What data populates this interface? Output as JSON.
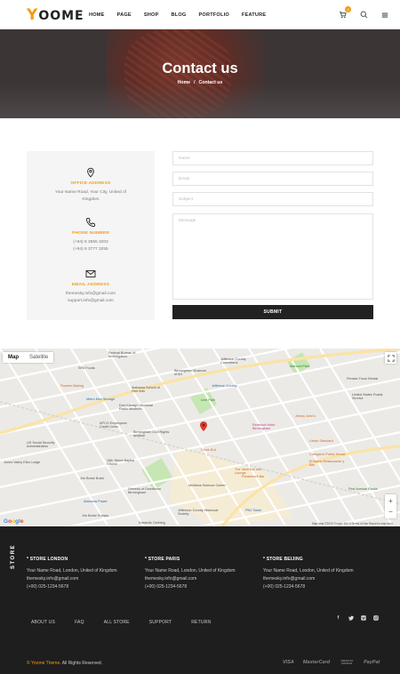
{
  "brand": {
    "logo_initial": "Y",
    "logo_rest": "OOME",
    "accent_color": "#f39c12"
  },
  "nav": {
    "items": [
      "HOME",
      "PAGE",
      "SHOP",
      "BLOG",
      "PORTFOLIO",
      "FEATURE"
    ],
    "cart_count": "0",
    "icons": [
      "cart-icon",
      "search-icon",
      "menu-icon"
    ]
  },
  "hero": {
    "title": "Contact us",
    "breadcrumb_home": "Home",
    "breadcrumb_sep": "/",
    "breadcrumb_current": "Contact us"
  },
  "contact_info": {
    "address_heading": "OFFICE ADDRESS",
    "address_text": "Your Name Road, Your City, United of Kingdom",
    "phone_heading": "PHONE NUMBER",
    "phone_1": "(+84) 8 3555 3203",
    "phone_2": "(+84) 8 3777 3255",
    "email_heading": "EMAIL ADDRESS",
    "email_1": "themesky.info@gmail.com",
    "email_2": "support.info@gmail.com"
  },
  "form": {
    "name_placeholder": "Name",
    "email_placeholder": "Email",
    "subject_placeholder": "Subject",
    "message_placeholder": "Message",
    "submit_label": "SUBMIT"
  },
  "map": {
    "tab_map": "Map",
    "tab_satellite": "Satellite",
    "google": "Google",
    "credits": "Map data ©2018 Google   500 ft   Terms of Use   Report a map error",
    "labels": [
      "Federal Bureau of Investigation",
      "SPA Foods",
      "Jefferson County Corrections",
      "Birmingham Museum of Art",
      "Marconi Park",
      "Jefferson County",
      "Penske Truck Rental",
      "Flowers Baking",
      "Alabama School of Fine Arts",
      "United States Postal Service",
      "Metro Mini Storage",
      "Linn Park",
      "Dorr Kavage Memorial Radio Museum",
      "APCO Employees Credit Union",
      "Birmingham Civil Rights Institute",
      "Redmont Hotel Birmingham",
      "Urban Standard",
      "US Social Security Administration",
      "Chick-fil-A",
      "16th Street Baptist Church",
      "Jim Burke Buick",
      "The Vault Bar and Lounge",
      "El Barrio Restaurante y Bar",
      "Jones Valley Elks Lodge",
      "Genesis of Downtown Birmingham",
      "Paramount Bar",
      "Alabama Power",
      "McWane Science Center",
      "First Avenue Rocks",
      "Jefferson County Historical Society",
      "Edwards Clothing",
      "PNC Bank",
      "Carrigan's Public House",
      "Jim Burke Subaru",
      "Jimmy John's"
    ]
  },
  "footer": {
    "store_vertical": "STORE",
    "stores": [
      {
        "title": "* STORE LONDON",
        "address": "Your Name Road, London, United of Kingdom",
        "email": "themesky.info@gmail.com",
        "phone": "(+00) 025-1234-5678"
      },
      {
        "title": "* STORE PARIS",
        "address": "Your Name Road, London, United of Kingdom",
        "email": "themesky.info@gmail.com",
        "phone": "(+00) 025-1234-5678"
      },
      {
        "title": "* STORE BEIJING",
        "address": "Your Name Road, London, United of Kingdom",
        "email": "themesky.info@gmail.com",
        "phone": "(+00) 025-1234-5678"
      }
    ],
    "links": [
      "ABOUT US",
      "FAQ",
      "ALL STORE",
      "SUPPORT",
      "RETURN"
    ],
    "social": [
      "facebook-icon",
      "twitter-icon",
      "vimeo-icon",
      "instagram-icon"
    ],
    "copyright_prefix": "©",
    "copyright_brand": "Yoome Theme",
    "copyright_suffix": ". All Rights Reserved.",
    "payments": [
      "VISA",
      "MasterCard",
      "AMERICAN EXPRESS",
      "PayPal"
    ]
  }
}
